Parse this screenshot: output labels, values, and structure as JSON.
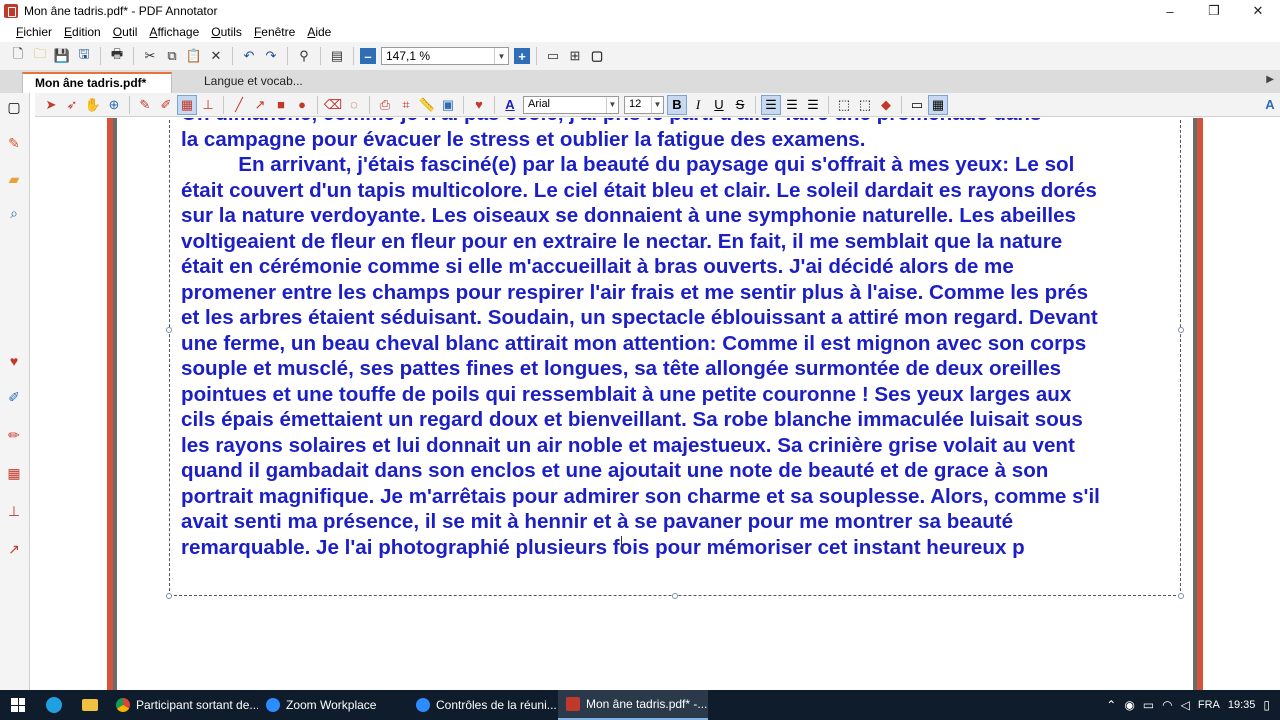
{
  "window": {
    "title": "Mon âne tadris.pdf* - PDF Annotator",
    "controls": [
      "–",
      "❐",
      "✕"
    ]
  },
  "menu": [
    "Fichier",
    "Edition",
    "Outil",
    "Affichage",
    "Outils",
    "Fenêtre",
    "Aide"
  ],
  "toolbar": {
    "zoom_value": "147,1 %",
    "zoom_minus": "–",
    "zoom_plus": "+"
  },
  "tabs": [
    {
      "label": "Mon âne tadris.pdf*",
      "active": true
    },
    {
      "label": "Langue et vocab...",
      "active": false
    }
  ],
  "format": {
    "font_name": "Arial",
    "font_size": "12",
    "bold": "B",
    "italic": "I",
    "underline": "U",
    "strike": "S",
    "text_color": "A"
  },
  "document": {
    "partial_first_line": "On dimanche, comme je n'ai pas école, j'ai pris le parti d'aller faire une promenade dans",
    "lines": [
      "la campagne pour évacuer le stress et oublier la fatigue des examens.",
      "          En arrivant, j'étais fasciné(e) par la beauté du paysage qui s'offrait à mes yeux: Le sol",
      "était couvert d'un tapis multicolore. Le ciel était bleu et clair. Le soleil dardait es rayons dorés",
      "sur la nature verdoyante. Les oiseaux se donnaient à une symphonie naturelle. Les abeilles",
      "voltigeaient de fleur en fleur pour en extraire le nectar. En fait, il me semblait que la nature",
      "était en cérémonie comme si elle m'accueillait à bras ouverts. J'ai décidé alors de me",
      "promener entre les champs pour respirer l'air frais et me sentir plus à l'aise. Comme les prés",
      "et les arbres étaient séduisant. Soudain, un spectacle éblouissant a attiré mon regard. Devant",
      "une ferme, un beau cheval blanc attirait mon attention: Comme il est mignon avec son corps",
      "souple et musclé, ses pattes fines et longues, sa tête allongée surmontée de deux oreilles",
      "pointues et une touffe de poils qui ressemblait à une petite couronne ! Ses yeux larges aux",
      "cils épais émettaient un regard doux et bienveillant. Sa robe blanche immaculée luisait sous",
      "les rayons solaires et lui donnait un air noble et majestueux. Sa crinière grise volait au vent",
      "quand il gambadait dans son enclos et une ajoutait une note de beauté et de grace à son",
      "portrait magnifique. Je m'arrêtais pour admirer son charme et sa souplesse. Alors, comme s'il",
      "avait senti ma présence, il se mit à hennir et à se pavaner pour me montrer sa beauté",
      "remarquable. Je l'ai photographié plusieurs fois pour mémoriser cet instant heureux p"
    ],
    "text_color": "#1c1fc4"
  },
  "taskbar": {
    "apps": [
      {
        "label": "Participant sortant de...",
        "color": "#e0a400"
      },
      {
        "label": "Zoom Workplace",
        "color": "#2d8cff"
      },
      {
        "label": "Contrôles de la réuni...",
        "color": "#2d8cff"
      },
      {
        "label": "Mon âne tadris.pdf* -...",
        "color": "#c0392b"
      }
    ],
    "lang": "FRA",
    "time": "19:35"
  }
}
